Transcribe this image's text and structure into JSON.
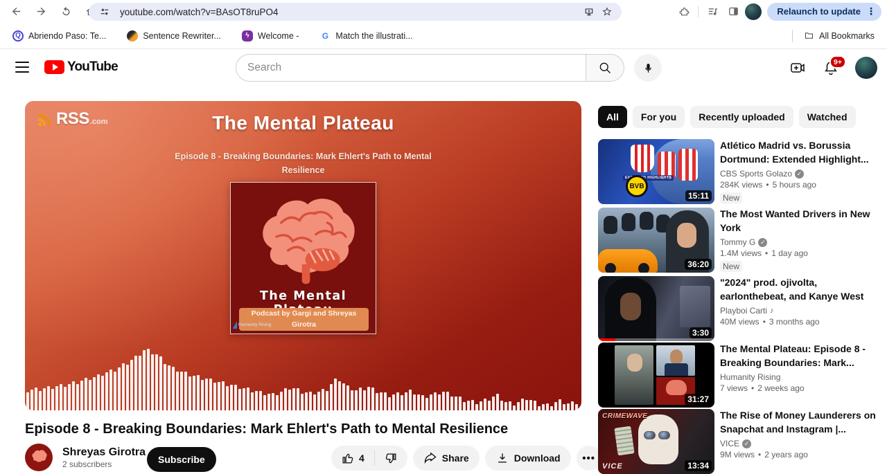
{
  "browser": {
    "url": "youtube.com/watch?v=BAsOT8ruPO4",
    "relaunch_label": "Relaunch to update",
    "bookmarks": [
      {
        "label": "Abriendo Paso: Te...",
        "favicon": "Q"
      },
      {
        "label": "Sentence Rewriter...",
        "favicon": ""
      },
      {
        "label": "Welcome -",
        "favicon": "S"
      },
      {
        "label": "Match the illustrati...",
        "favicon": "G"
      }
    ],
    "all_bookmarks_label": "All Bookmarks"
  },
  "header": {
    "logo_text": "YouTube",
    "search_placeholder": "Search",
    "notification_count": "9+"
  },
  "player": {
    "brand": "RSS",
    "brand_tld": ".com",
    "title": "The Mental Plateau",
    "subtitle": "Episode 8 - Breaking Boundaries: Mark Ehlert's Path to Mental Resilience",
    "cover": {
      "title": "The Mental Plateau",
      "byline": "Podcast by Gargi and Shreyas Girotra",
      "logo_text": "Humanity Rising"
    }
  },
  "video": {
    "title": "Episode 8 - Breaking Boundaries: Mark Ehlert's Path to Mental Resilience",
    "channel": "Shreyas Girotra",
    "subscribers": "2 subscribers",
    "subscribe_label": "Subscribe",
    "like_count": "4",
    "share_label": "Share",
    "download_label": "Download",
    "more_label": "..."
  },
  "sidebar": {
    "chips": [
      {
        "label": "All"
      },
      {
        "label": "For you"
      },
      {
        "label": "Recently uploaded"
      },
      {
        "label": "Watched"
      }
    ],
    "videos": [
      {
        "title": "Atlético Madrid vs. Borussia Dortmund: Extended Highlight...",
        "channel": "CBS Sports Golazo",
        "verified": true,
        "views": "284K views",
        "age": "5 hours ago",
        "duration": "15:11",
        "badge": "New",
        "thumb_text": "BVB",
        "thumb_text2": "EXTENDED HIGHLIGHTS"
      },
      {
        "title": "The Most Wanted Drivers in New York",
        "channel": "Tommy G",
        "verified": true,
        "views": "1.4M views",
        "age": "1 day ago",
        "duration": "36:20",
        "badge": "New"
      },
      {
        "title": "\"2024\" prod. ojivolta, earlonthebeat, and Kanye West",
        "channel": "Playboi Carti",
        "music": true,
        "views": "40M views",
        "age": "3 months ago",
        "duration": "3:30"
      },
      {
        "title": "The Mental Plateau: Episode 8 - Breaking Boundaries: Mark...",
        "channel": "Humanity Rising",
        "views": "7 views",
        "age": "2 weeks ago",
        "duration": "31:27"
      },
      {
        "title": "The Rise of Money Launderers on Snapchat and Instagram |...",
        "channel": "VICE",
        "verified": true,
        "views": "9M views",
        "age": "2 years ago",
        "duration": "13:34",
        "thumb_text": "CRIMEWAVE",
        "thumb_text2": "VICE"
      }
    ]
  }
}
